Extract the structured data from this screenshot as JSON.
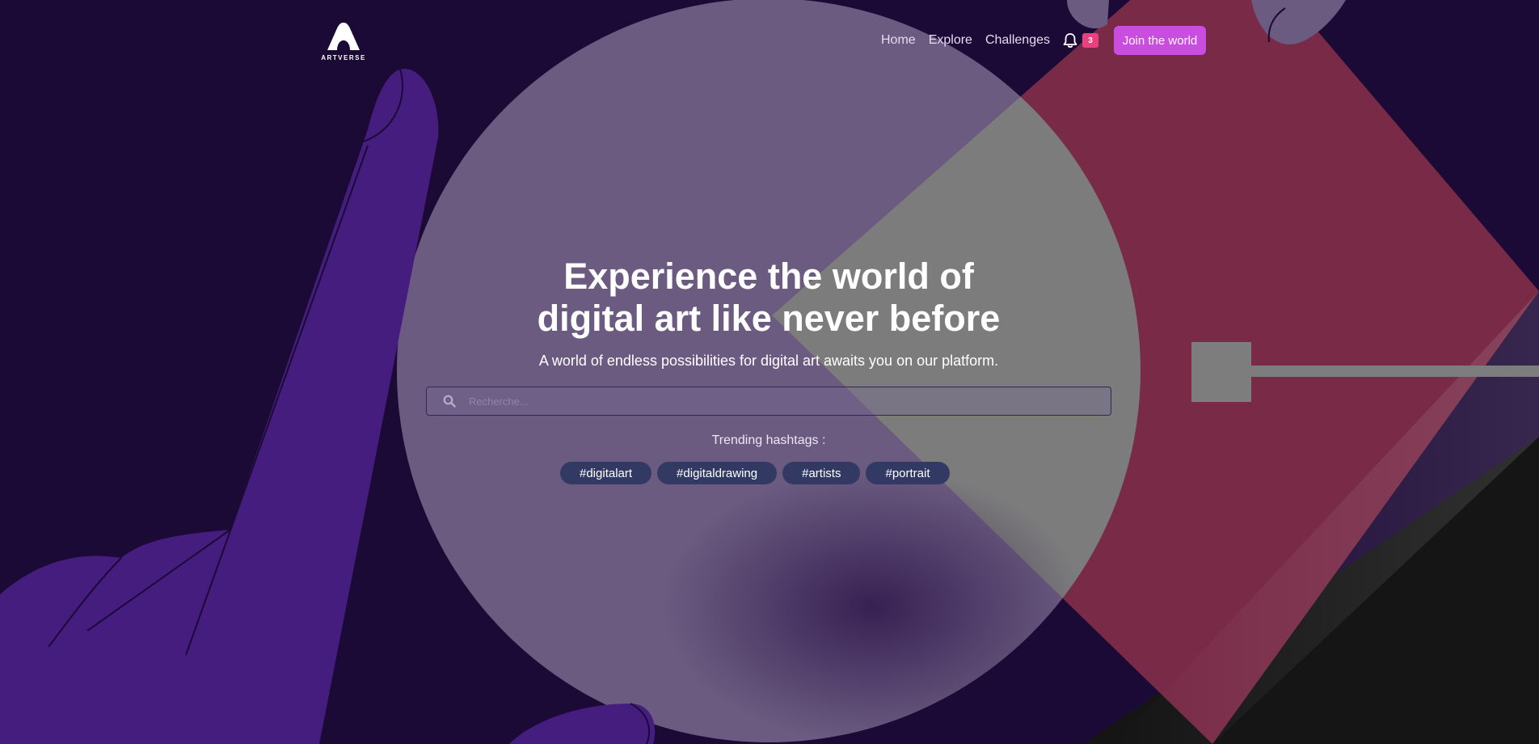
{
  "brand": {
    "logo_text": "ARTVERSE"
  },
  "nav": {
    "items": [
      {
        "label": "Home"
      },
      {
        "label": "Explore"
      },
      {
        "label": "Challenges"
      }
    ],
    "notifications_count": "3",
    "cta_label": "Join the world"
  },
  "hero": {
    "headline_line1": "Experience the world of",
    "headline_line2": "digital art like never before",
    "subtitle": "A world of endless possibilities for digital art awaits you on our platform."
  },
  "search": {
    "placeholder": "Recherche..."
  },
  "trending": {
    "label": "Trending hashtags :",
    "tags": [
      "#digitalart",
      "#digitaldrawing",
      "#artists",
      "#portrait"
    ]
  },
  "colors": {
    "background": "#1c0a36",
    "circle": "#6b5b80",
    "diamond": "#782a46",
    "accent_button": "#c94ee0",
    "badge": "#e8417f",
    "hand": "#441d7e",
    "tag": "#323a63"
  }
}
